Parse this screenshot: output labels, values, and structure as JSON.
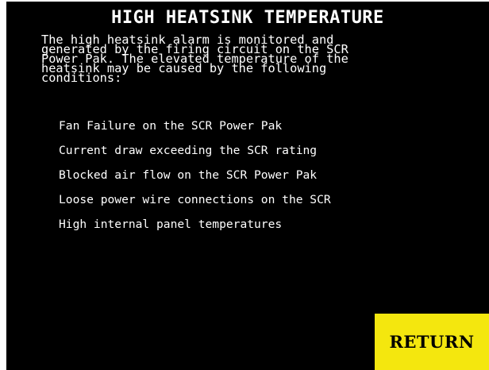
{
  "screen": {
    "title": "HIGH HEATSINK TEMPERATURE",
    "description_lines": [
      "The high heatsink alarm is monitored and",
      "generated by the firing circuit on the SCR",
      "Power Pak. The elevated temperature of the",
      "heatsink may be caused by the following",
      "conditions:"
    ],
    "conditions": [
      "Fan Failure on the SCR Power Pak",
      "Current draw exceeding the SCR rating",
      "Blocked air flow on the SCR Power Pak",
      "Loose power wire connections on the SCR",
      "High internal panel temperatures"
    ],
    "return_button_label": "RETURN"
  },
  "colors": {
    "background": "#000000",
    "text": "#ffffff",
    "button": "#f4e70e",
    "button_text": "#000000"
  }
}
